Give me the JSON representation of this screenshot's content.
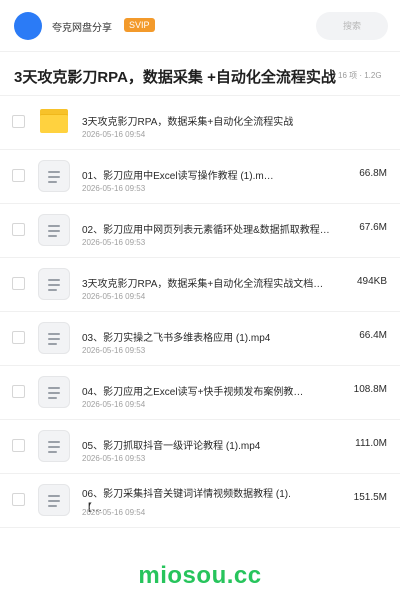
{
  "header": {
    "brand": "夸克网盘分享",
    "badge": "SVIP",
    "search_placeholder": "搜索"
  },
  "title": {
    "text": "3天攻克影刀RPA，数据采集 +自动化全流程实战",
    "meta": "16 项 · 1.2G"
  },
  "files": [
    {
      "name": "3天攻克影刀RPA，数据采集+自动化全流程实战",
      "date": "2026-05-16 09:54",
      "size": "",
      "icon": "folder-icon"
    },
    {
      "name": "01、影刀应用中Excel读写操作教程 (1).m…",
      "date": "2026-05-16 09:53",
      "size": "66.8M",
      "icon": "document-icon"
    },
    {
      "name": "02、影刀应用中网页列表元素循环处理&数据抓取教程…",
      "date": "2026-05-16 09:53",
      "size": "67.6M",
      "icon": "document-icon"
    },
    {
      "name": "3天攻克影刀RPA，数据采集+自动化全流程实战文档…",
      "date": "2026-05-16 09:54",
      "size": "494KB",
      "icon": "document-icon"
    },
    {
      "name": "03、影刀实操之飞书多维表格应用 (1).mp4",
      "date": "2026-05-16 09:53",
      "size": "66.4M",
      "icon": "document-icon"
    },
    {
      "name": "04、影刀应用之Excel读写+快手视频发布案例教…",
      "date": "2026-05-16 09:54",
      "size": "108.8M",
      "icon": "document-icon"
    },
    {
      "name": "05、影刀抓取抖音一级评论教程 (1).mp4",
      "date": "2026-05-16 09:53",
      "size": "111.0M",
      "icon": "document-icon"
    },
    {
      "name": "06、影刀采集抖音关键词详情视频数据教程 (1).【…",
      "date": "2026-05-16 09:54",
      "size": "151.5M",
      "icon": "document-icon"
    }
  ],
  "footer": {
    "watermark": "miosou.cc"
  }
}
